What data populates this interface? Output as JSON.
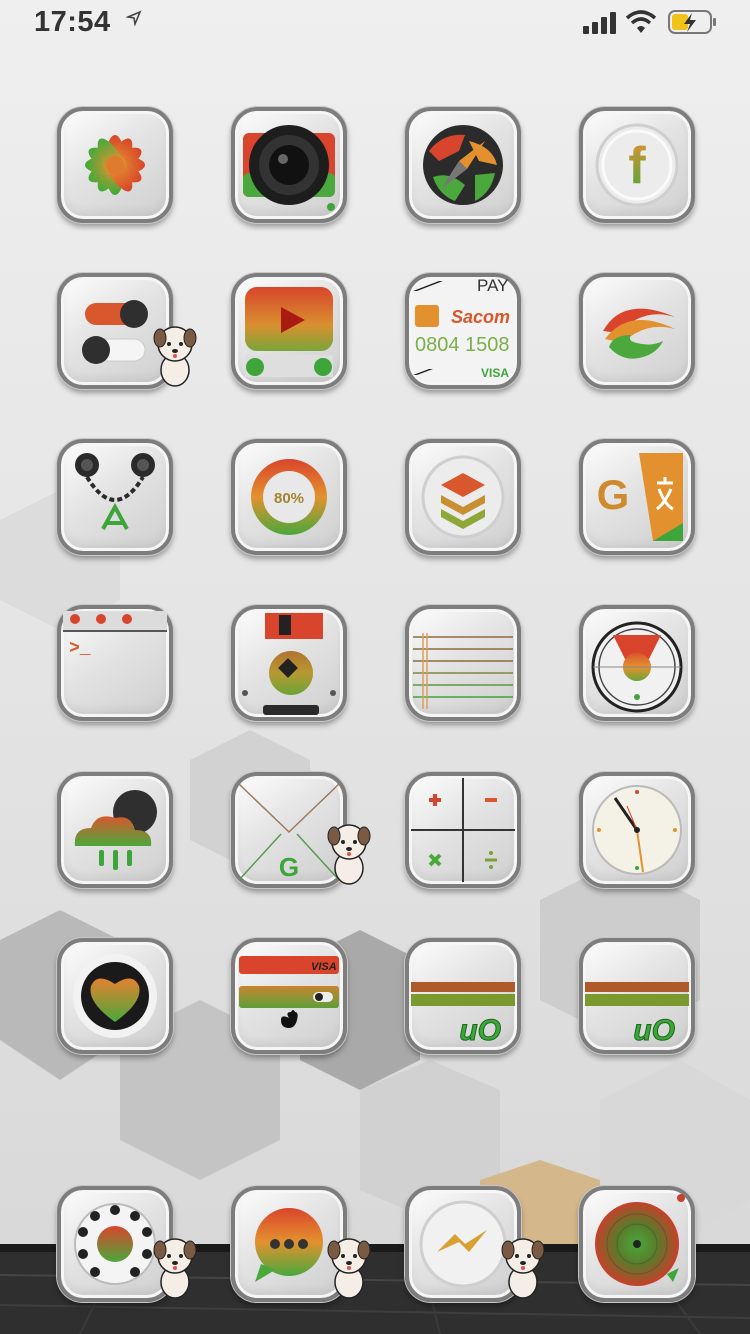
{
  "status_bar": {
    "time": "17:54"
  },
  "icons": {
    "row1": [
      "flower-icon",
      "camera-icon",
      "safari-icon",
      "facebook-icon"
    ],
    "row2": [
      "settings-icon",
      "youtube-icon",
      "sacombank-pay-icon",
      "zing-icon"
    ],
    "row3": [
      "app-store-icon",
      "battery-percent-icon",
      "stack-icon",
      "google-translate-icon"
    ],
    "row4": [
      "terminal-icon",
      "floppy-disk-icon",
      "notes-icon",
      "radar-icon"
    ],
    "row5": [
      "weather-icon",
      "gmail-icon",
      "calculator-icon",
      "clock-icon"
    ],
    "row6": [
      "health-heart-icon",
      "wallet-icon",
      "uo-icon",
      "uo-icon"
    ],
    "dock": [
      "phone-dial-icon",
      "messages-icon",
      "messenger-icon",
      "music-record-icon"
    ]
  },
  "icon_text": {
    "pay": "PAY",
    "sacom": "Sacom",
    "card_number": "0804 1508",
    "visa_small": "VISA",
    "percent": "80%",
    "visa_wallet": "VISA",
    "uo_1": "uO",
    "uo_2": "uO",
    "facebook_letter": "f",
    "gmail_letter": "G",
    "translate_letter": "G",
    "terminal_prompt": ">_"
  },
  "colors": {
    "accent_red": "#d9412b",
    "accent_orange": "#e58a2e",
    "accent_green": "#3fae38",
    "frame_gray": "#7d7d7d"
  }
}
